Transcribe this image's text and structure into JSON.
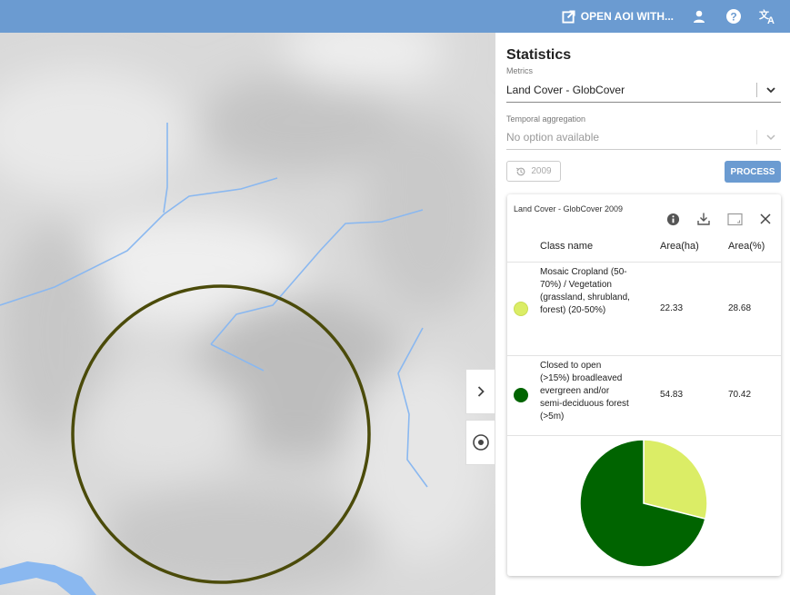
{
  "topbar": {
    "open_aoi_label": "OPEN AOI WITH...",
    "icons": [
      "open-external-icon",
      "user-icon",
      "help-icon",
      "translate-icon"
    ]
  },
  "map": {
    "expand_icon": "chevron-right-icon",
    "locate_icon": "target-icon"
  },
  "panel": {
    "title": "Statistics",
    "metrics_label": "Metrics",
    "metrics_value": "Land Cover - GlobCover",
    "temporal_label": "Temporal aggregation",
    "temporal_value": "No option available",
    "year_label": "2009",
    "process_label": "PROCESS"
  },
  "card": {
    "title": "Land Cover - GlobCover 2009",
    "icons": [
      "info-icon",
      "download-icon",
      "image-icon",
      "close-icon"
    ],
    "table": {
      "headers": [
        "Class name",
        "Area(ha)",
        "Area(%)"
      ],
      "rows": [
        {
          "class_name": "Mosaic Cropland (50-70%) / Vegetation (grassland, shrubland, forest) (20-50%)",
          "area_ha": "22.33",
          "area_pct": "28.68",
          "color": "#dbed66"
        },
        {
          "class_name": "Closed to open (>15%) broadleaved evergreen and/or semi-deciduous forest (>5m)",
          "area_ha": "54.83",
          "area_pct": "70.42",
          "color": "#006400"
        }
      ]
    }
  },
  "chart_data": {
    "type": "pie",
    "categories": [
      "Mosaic Cropland (50-70%) / Vegetation (grassland, shrubland, forest) (20-50%)",
      "Closed to open (>15%) broadleaved evergreen and/or semi-deciduous forest (>5m)"
    ],
    "values": [
      28.68,
      70.42
    ],
    "colors": [
      "#dbed66",
      "#006400"
    ]
  },
  "colors": {
    "accent": "#6b9bd1",
    "aoi_circle": "#4b4b0a",
    "rivers": "#8ab8f0"
  }
}
